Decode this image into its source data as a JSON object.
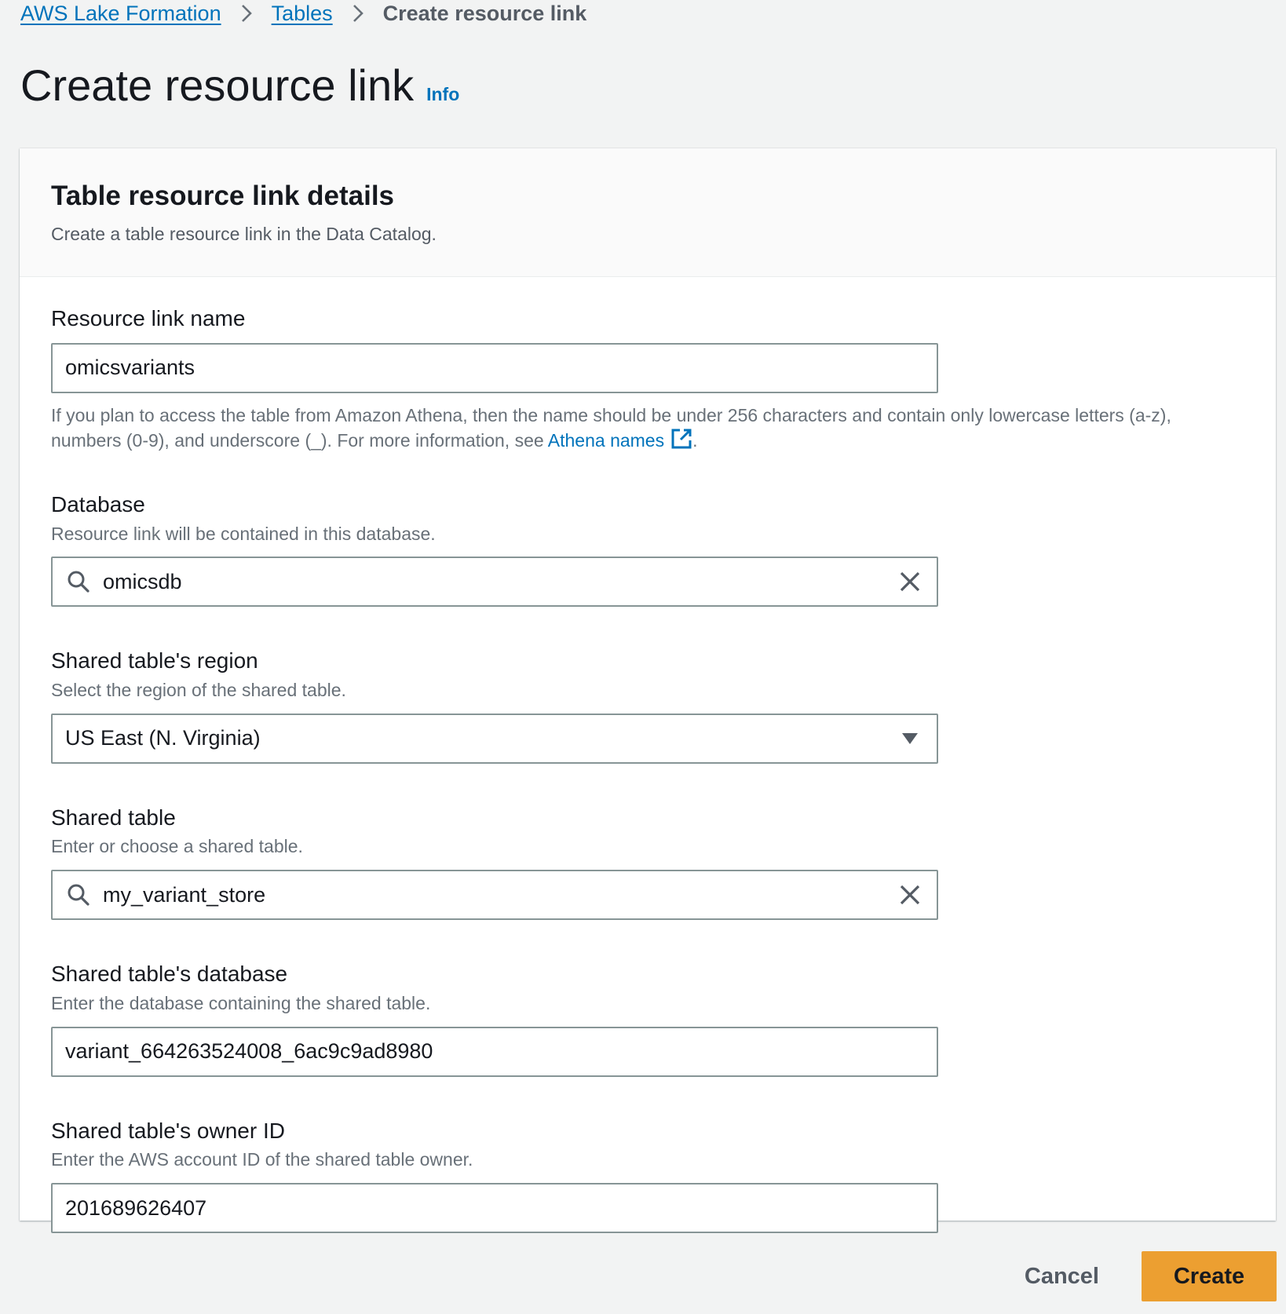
{
  "breadcrumb": {
    "items": [
      {
        "label": "AWS Lake Formation"
      },
      {
        "label": "Tables"
      },
      {
        "label": "Create resource link"
      }
    ]
  },
  "header": {
    "title": "Create resource link",
    "info_label": "Info"
  },
  "panel": {
    "title": "Table resource link details",
    "description": "Create a table resource link in the Data Catalog."
  },
  "fields": {
    "resource_link_name": {
      "label": "Resource link name",
      "value": "omicsvariants",
      "help_prefix": "If you plan to access the table from Amazon Athena, then the name should be under 256 characters and contain only lowercase letters (a-z), numbers (0-9), and underscore (_). For more information, see ",
      "help_link": "Athena names",
      "help_suffix": "."
    },
    "database": {
      "label": "Database",
      "description": "Resource link will be contained in this database.",
      "value": "omicsdb"
    },
    "shared_region": {
      "label": "Shared table's region",
      "description": "Select the region of the shared table.",
      "value": "US East (N. Virginia)"
    },
    "shared_table": {
      "label": "Shared table",
      "description": "Enter or choose a shared table.",
      "value": "my_variant_store"
    },
    "shared_database": {
      "label": "Shared table's database",
      "description": "Enter the database containing the shared table.",
      "value": "variant_664263524008_6ac9c9ad8980"
    },
    "owner_id": {
      "label": "Shared table's owner ID",
      "description": "Enter the AWS account ID of the shared table owner.",
      "value": "201689626407"
    }
  },
  "actions": {
    "cancel_label": "Cancel",
    "create_label": "Create"
  },
  "colors": {
    "link": "#0073bb",
    "primary_button": "#ec9f31",
    "background": "#f2f3f3"
  },
  "icons": {
    "breadcrumb_separator": "chevron-right-icon",
    "search": "search-icon",
    "clear": "close-icon",
    "dropdown": "caret-down-icon",
    "external_link": "external-link-icon"
  }
}
